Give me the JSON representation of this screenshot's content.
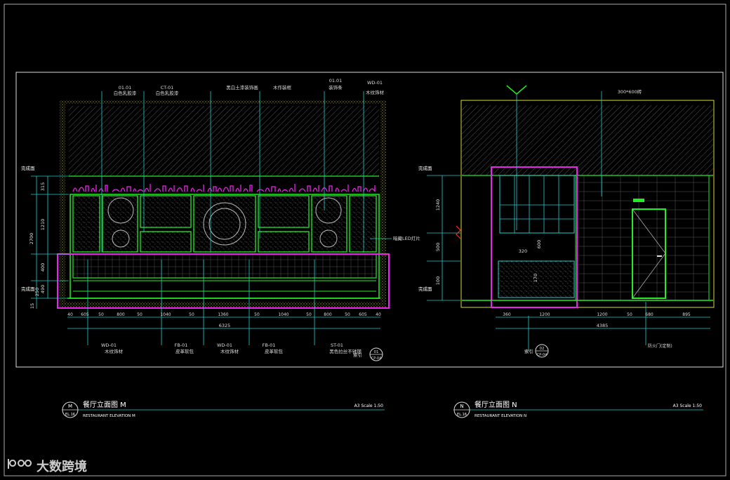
{
  "colors": {
    "background": "#000000",
    "frame": "#ffffff",
    "green": "#22ee22",
    "magenta": "#ee22ee",
    "cyan": "#22cccc",
    "yellow": "#dddd33",
    "white": "#ffffff"
  },
  "elevation_m": {
    "tags": [
      {
        "code": "01.01",
        "text": "白色乳胶漆"
      },
      {
        "code": "CT-01",
        "text": "白色乳胶漆"
      },
      {
        "code": "",
        "text": "黑白土漆装饰画"
      },
      {
        "code": "",
        "text": "木作装框"
      },
      {
        "code": "01.01",
        "text": "装饰条"
      },
      {
        "code": "WD-01",
        "text": "木纹饰材"
      }
    ],
    "left_dims": [
      "315",
      "1210",
      "2700",
      "400",
      "490",
      "250",
      "15"
    ],
    "level_marks": [
      "完成面",
      "完成面"
    ],
    "bottom_dims": [
      "40",
      "605",
      "50",
      "800",
      "50",
      "1040",
      "50",
      "1360",
      "50",
      "1040",
      "50",
      "800",
      "50",
      "605",
      "40"
    ],
    "total_dim": "6325",
    "led_label": "暗藏LED灯片",
    "bottom_tags": [
      {
        "code": "WD-01",
        "text": "木纹饰材"
      },
      {
        "code": "FB-01",
        "text": "皮革软包"
      },
      {
        "code": "WD-01",
        "text": "木纹饰材"
      },
      {
        "code": "FB-01",
        "text": "皮革软包"
      },
      {
        "code": "ST-01",
        "text": "黑色拉丝不锈钢"
      }
    ],
    "index": {
      "prefix": "索引",
      "top": "01",
      "bottom": "CP-04"
    },
    "title": {
      "letter": "M",
      "sheet": "EL.16",
      "cn": "餐厅立面图 M",
      "en": "RESTAURANT ELEVATION M",
      "scale": "A3 Scale 1:50"
    }
  },
  "elevation_n": {
    "tag": {
      "code": "",
      "text": "300*600砖"
    },
    "left_dims": [
      "1240",
      "500",
      "100"
    ],
    "level_marks": [
      "完成面",
      "完成面"
    ],
    "inner_dims": [
      "320",
      "600",
      "170"
    ],
    "bottom_dims": [
      "360",
      "1200",
      "1200",
      "50",
      "680",
      "895"
    ],
    "total_dim": "4385",
    "door_label": "防火门(定制)",
    "index": {
      "prefix": "索引",
      "top": "02",
      "bottom": "CP-04"
    },
    "title": {
      "letter": "N",
      "sheet": "EL.16",
      "cn": "餐厅立面图 N",
      "en": "RESTAURANT ELEVATION N",
      "scale": "A3 Scale 1:50"
    }
  },
  "watermark": {
    "text": "大数跨境"
  }
}
